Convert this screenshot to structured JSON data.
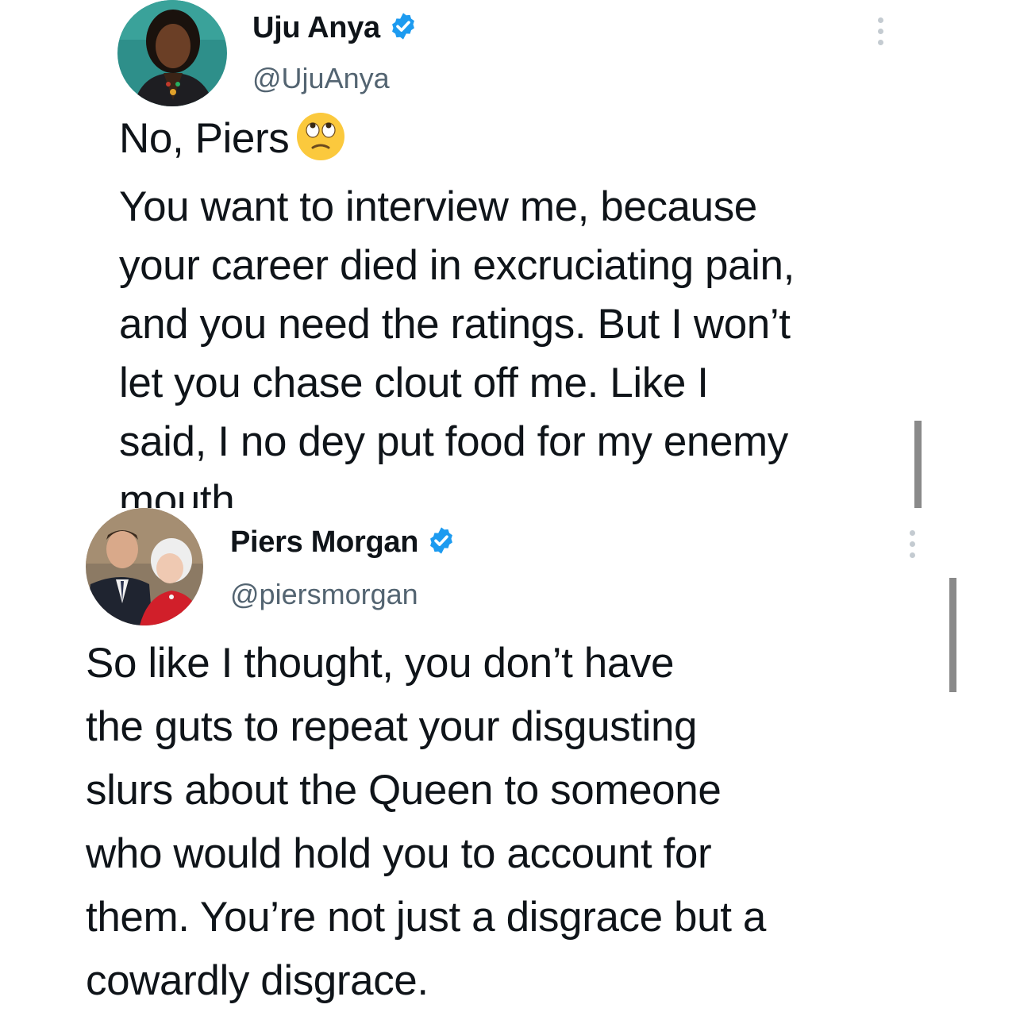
{
  "tweets": [
    {
      "author": {
        "display_name": "Uju Anya",
        "handle": "@UjuAnya",
        "verified": true
      },
      "text_lines": [
        "No, Piers",
        "You want to interview me, because",
        "your career died in excruciating pain,",
        "and you need the ratings. But I won’t",
        "let you chase clout off me. Like I",
        "said, I no dey put food for my enemy",
        "mouth."
      ],
      "emoji": "face-with-rolling-eyes-icon"
    },
    {
      "author": {
        "display_name": "Piers Morgan",
        "handle": "@piersmorgan",
        "verified": true
      },
      "text_lines": [
        "So like I thought, you don’t have",
        "the guts to repeat your disgusting",
        "slurs about the Queen to someone",
        "who would hold you to account for",
        "them. You’re not just a disgrace but a",
        "cowardly disgrace."
      ]
    }
  ],
  "colors": {
    "verified_badge": "#1d9bf0",
    "text": "#0f1419",
    "handle": "#536471"
  }
}
